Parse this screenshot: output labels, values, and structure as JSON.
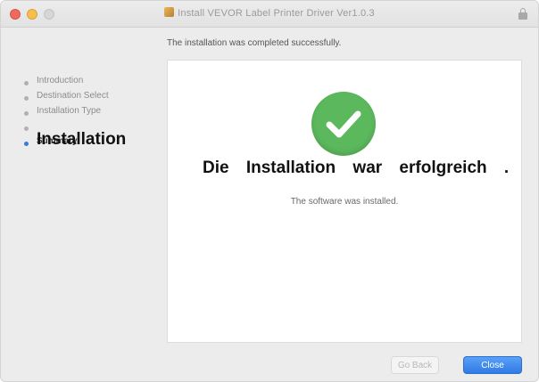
{
  "window": {
    "title": "Install VEVOR Label Printer Driver Ver1.0.3"
  },
  "header": {
    "message": "The installation was completed successfully."
  },
  "sidebar": {
    "steps": [
      {
        "label": "Introduction"
      },
      {
        "label": "Destination Select"
      },
      {
        "label": "Installation Type"
      },
      {
        "label": ""
      },
      {
        "label": "Summary"
      }
    ],
    "current_step_overlay": "Installation"
  },
  "content": {
    "status_icon": "checkmark-circle-icon",
    "overlay_message": "Die Installation war erfolgreich .",
    "sub_message": "The software was installed."
  },
  "footer": {
    "back_label": "Go Back",
    "close_label": "Close"
  },
  "colors": {
    "success_green": "#5cb85c",
    "primary_blue": "#2f7be6"
  }
}
